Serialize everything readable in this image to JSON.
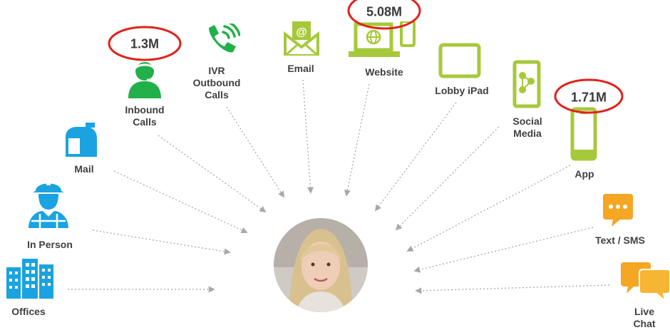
{
  "channels": {
    "offices": {
      "label": "Offices"
    },
    "in_person": {
      "label": "In Person"
    },
    "mail": {
      "label": "Mail"
    },
    "inbound_calls": {
      "label": "Inbound\nCalls",
      "metric": "1.3M"
    },
    "ivr": {
      "label": "IVR\nOutbound\nCalls"
    },
    "email": {
      "label": "Email"
    },
    "website": {
      "label": "Website",
      "metric": "5.08M"
    },
    "lobby_ipad": {
      "label": "Lobby iPad"
    },
    "social_media": {
      "label": "Social\nMedia"
    },
    "app": {
      "label": "App",
      "metric": "1.71M"
    },
    "text_sms": {
      "label": "Text / SMS"
    },
    "live_chat": {
      "label": "Live Chat"
    }
  },
  "colors": {
    "blue": "#1aa3e0",
    "green": "#22b04b",
    "lime": "#a6c93a",
    "orange": "#f5a623",
    "highlight": "#e0221c",
    "arrow": "#a8a8a8"
  },
  "center": {
    "icon": "customer-photo"
  }
}
